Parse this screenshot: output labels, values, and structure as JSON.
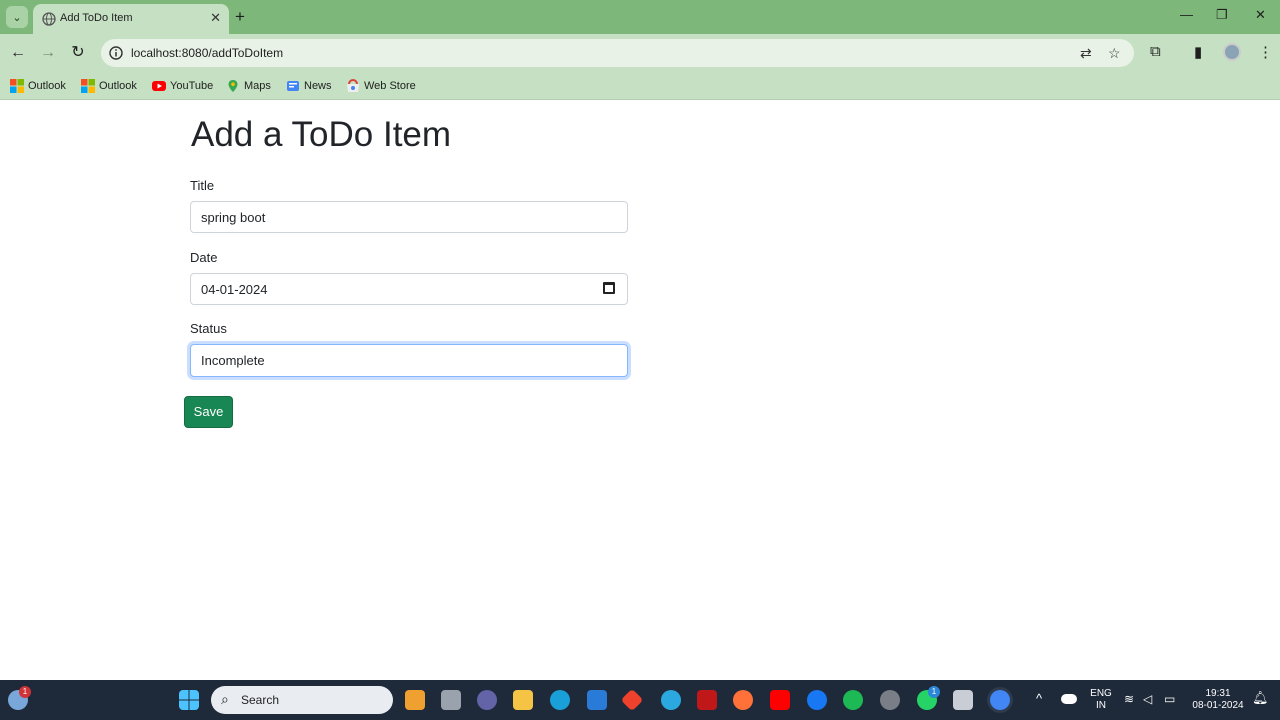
{
  "browser": {
    "tab_title": "Add ToDo Item",
    "url": "localhost:8080/addToDoItem",
    "bookmarks": [
      {
        "label": "Outlook",
        "icon": "windows-logo-icon"
      },
      {
        "label": "Outlook",
        "icon": "windows-logo-icon"
      },
      {
        "label": "YouTube",
        "icon": "youtube-icon"
      },
      {
        "label": "Maps",
        "icon": "maps-icon"
      },
      {
        "label": "News",
        "icon": "news-icon"
      },
      {
        "label": "Web Store",
        "icon": "web-store-icon"
      }
    ]
  },
  "page": {
    "heading": "Add a ToDo Item",
    "fields": {
      "title": {
        "label": "Title",
        "value": "spring boot"
      },
      "date": {
        "label": "Date",
        "value": "04-01-2024"
      },
      "status": {
        "label": "Status",
        "value": "Incomplete"
      }
    },
    "save_label": "Save"
  },
  "taskbar": {
    "search_label": "Search",
    "weather_badge": "1",
    "whatsapp_badge": "1",
    "language_line1": "ENG",
    "language_line2": "IN",
    "time": "19:31",
    "date": "08-01-2024"
  },
  "colors": {
    "browser_frame": "#7db87a",
    "toolbar": "#c5e0c2",
    "save_button": "#198754",
    "focus_ring": "#86b7fe",
    "taskbar": "#1e2a3a"
  }
}
